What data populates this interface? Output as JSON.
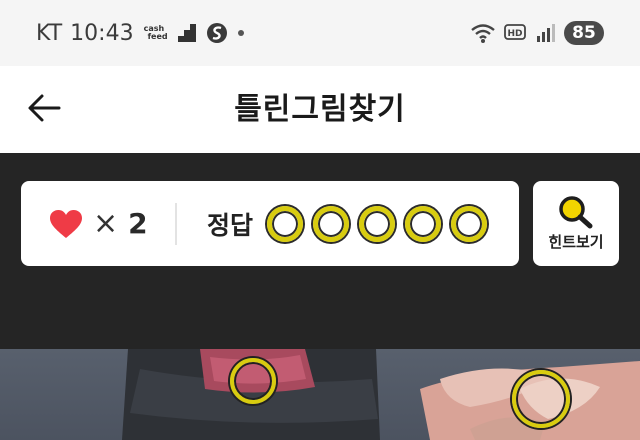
{
  "status_bar": {
    "carrier": "KT",
    "time": "10:43",
    "cashfeed_top": "cash",
    "cashfeed_bottom": "feed",
    "hd_label": "HD",
    "battery": "85"
  },
  "header": {
    "title": "틀린그림찾기"
  },
  "game": {
    "lives_prefix": "×",
    "lives_count": "2",
    "answers_label": "정답",
    "answers_total": 5,
    "answers_found": 0,
    "hint_label": "힌트보기"
  },
  "puzzle": {
    "markers_found": 2
  },
  "colors": {
    "panel_bg": "#252525",
    "marker_yellow": "#d8cc10",
    "heart_red": "#ef3b46",
    "hint_icon_yellow": "#f2d400"
  },
  "icons": {
    "back": "arrow-left-icon",
    "heart": "heart-icon",
    "hint": "magnifier-icon",
    "wifi": "wifi-icon",
    "signal": "signal-icon"
  }
}
